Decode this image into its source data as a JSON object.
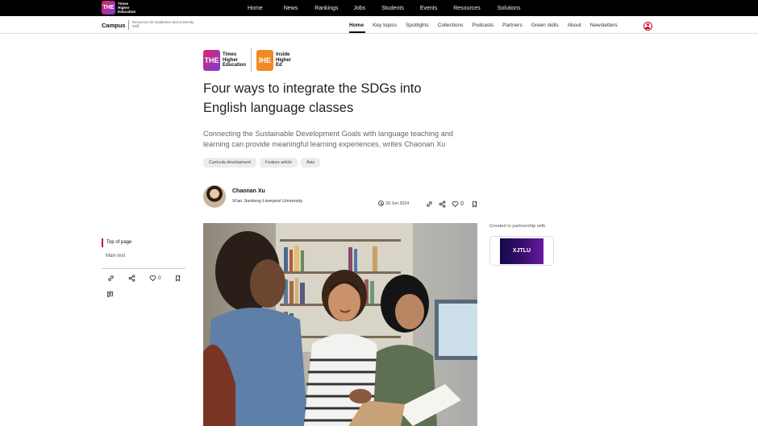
{
  "topbar": {
    "logo_lines": [
      "Times",
      "Higher",
      "Education"
    ],
    "logo_mark": "THE",
    "nav": [
      "Home",
      "News",
      "Rankings",
      "Jobs",
      "Students",
      "Events",
      "Resources",
      "Solutions"
    ]
  },
  "subbar": {
    "section": "Campus",
    "tagline": "Resources for academics and university staff",
    "nav": [
      "Home",
      "Key topics",
      "Spotlights",
      "Collections",
      "Podcasts",
      "Partners",
      "Green skills",
      "About",
      "Newsletters"
    ],
    "active": "Home",
    "user_icon": "user-icon",
    "accent_color": "#d0021b"
  },
  "publishers": {
    "the_mark": "THE",
    "the_label": [
      "Times",
      "Higher",
      "Education"
    ],
    "ihe_mark": "IHE",
    "ihe_label": [
      "Inside",
      "Higher",
      "Ed"
    ]
  },
  "article": {
    "headline_line1": "Four ways to integrate the SDGs into",
    "headline_line2": "English language classes",
    "standfirst": "Connecting the Sustainable Development Goals with language teaching and learning can provide meaningful learning experiences, writes Chaonan Xu",
    "tags": [
      "Curricula development",
      "Feature article",
      "Asia"
    ],
    "author_name": "Chaonan Xu",
    "author_institution": "Xi'an Jiaotong-Liverpool University",
    "date": "28 Jun 2024",
    "like_count": "0"
  },
  "sidebar": {
    "toc_active": "Top of page",
    "toc_items": [
      "Main text"
    ],
    "like_count": "0",
    "toc_accent": "#c5003e"
  },
  "partner": {
    "label": "Created in partnership with",
    "logo_text": "XJTLU"
  }
}
